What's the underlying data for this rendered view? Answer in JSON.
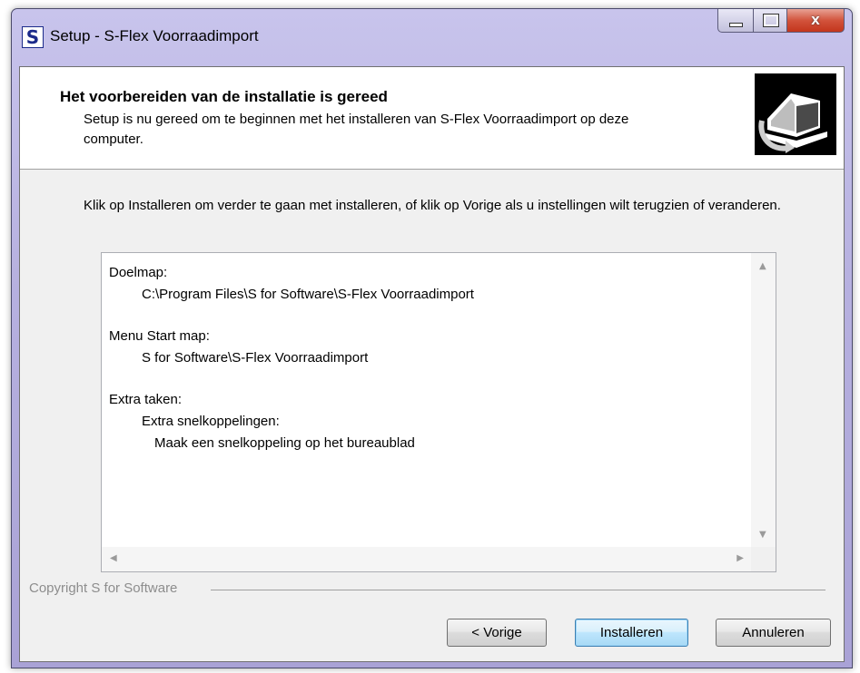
{
  "window": {
    "title": "Setup - S-Flex Voorraadimport",
    "icon_letter": "S",
    "caption_buttons": {
      "minimize": "minimize-icon",
      "maximize": "maximize-icon",
      "close": "x"
    }
  },
  "header": {
    "title": "Het voorbereiden van de installatie is gereed",
    "subtitle": "Setup is nu gereed om te beginnen met het installeren van S-Flex Voorraadimport op deze computer."
  },
  "body": {
    "instruction": "Klik op Installeren om verder te gaan met installeren, of klik op Vorige als u instellingen wilt terugzien of veranderen."
  },
  "memo": {
    "dest_label": "Doelmap:",
    "dest_value": "C:\\Program Files\\S for Software\\S-Flex Voorraadimport",
    "menu_label": "Menu Start map:",
    "menu_value": "S for Software\\S-Flex Voorraadimport",
    "tasks_label": "Extra taken:",
    "tasks_sub_label": "Extra snelkoppelingen:",
    "tasks_item": "Maak een snelkoppeling op het bureaublad"
  },
  "footer": {
    "copyright": "Copyright S for Software"
  },
  "buttons": {
    "back": "< Vorige",
    "install": "Installeren",
    "cancel": "Annuleren"
  },
  "colors": {
    "title_bar": "#b7b1e0",
    "close_button": "#c3351c",
    "default_button_border": "#3c7fb1",
    "dialog_background": "#f0f0f0"
  }
}
